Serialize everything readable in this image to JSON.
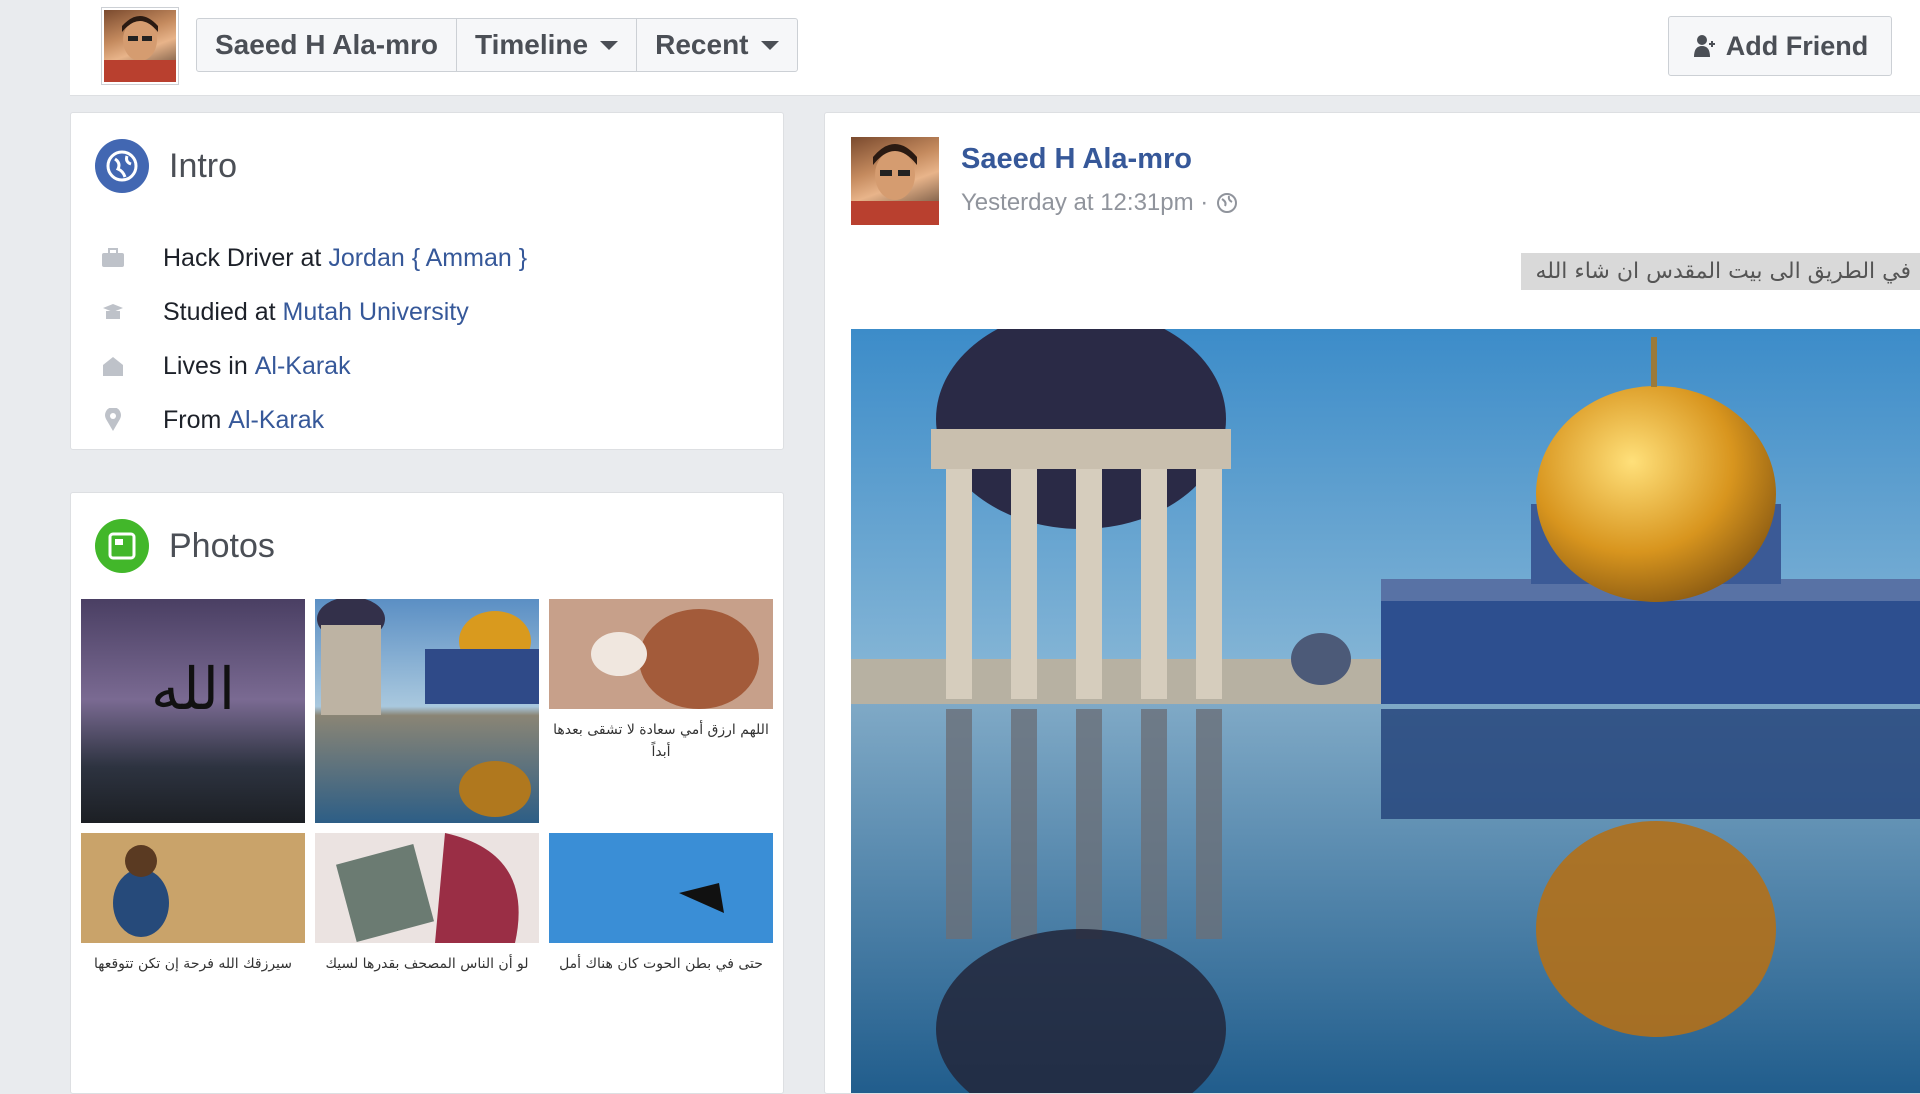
{
  "header": {
    "profile_name": "Saeed H Ala-mro",
    "timeline_label": "Timeline",
    "recent_label": "Recent",
    "add_friend_label": "Add Friend"
  },
  "intro": {
    "title": "Intro",
    "items": [
      {
        "icon": "briefcase-icon",
        "prefix": "Hack Driver at ",
        "link": "Jordan { Amman }"
      },
      {
        "icon": "graduation-cap-icon",
        "prefix": "Studied at ",
        "link": "Mutah University"
      },
      {
        "icon": "house-icon",
        "prefix": "Lives in ",
        "link": "Al-Karak"
      },
      {
        "icon": "location-pin-icon",
        "prefix": "From ",
        "link": "Al-Karak"
      }
    ]
  },
  "photos": {
    "title": "Photos",
    "captions": [
      "",
      "",
      "اللهم ارزق أمي سعادة لا تشقى بعدها أبداً",
      "سيرزقك الله فرحة إن تكن تتوقعها",
      "لو أن الناس المصحف بقدرها لسيك",
      "حتى في بطن الحوت كان هناك أمل"
    ]
  },
  "post": {
    "author": "Saeed H Ala-mro",
    "timestamp": "Yesterday at 12:31pm ·",
    "text": "في الطريق الى بيت المقدس ان شاء الله"
  },
  "colors": {
    "link": "#365899",
    "intro_icon_bg": "#4267b2",
    "photos_icon_bg": "#42b72a"
  }
}
